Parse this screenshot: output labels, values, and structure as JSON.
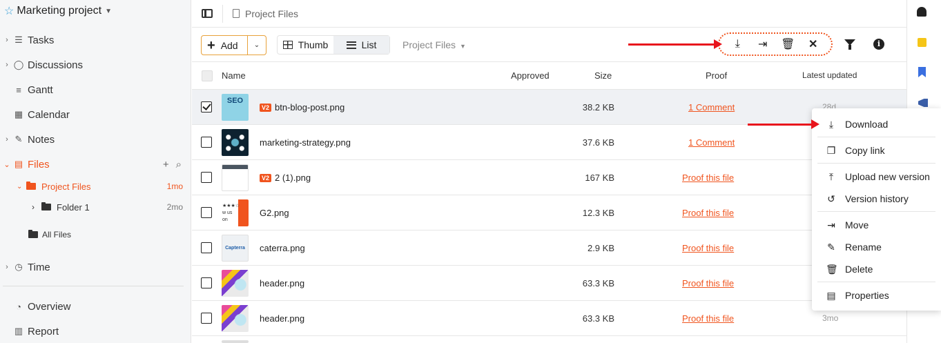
{
  "sidebar": {
    "project_title": "Marketing project",
    "nav": [
      {
        "label": "Tasks"
      },
      {
        "label": "Discussions"
      },
      {
        "label": "Gantt"
      },
      {
        "label": "Calendar"
      },
      {
        "label": "Notes"
      },
      {
        "label": "Files"
      },
      {
        "label": "Time"
      },
      {
        "label": "Overview"
      },
      {
        "label": "Report"
      }
    ],
    "files_tree": {
      "project_files": {
        "label": "Project Files",
        "updated": "1mo"
      },
      "folder1": {
        "label": "Folder 1",
        "updated": "2mo"
      },
      "all_files": {
        "label": "All Files"
      }
    }
  },
  "topbar": {
    "breadcrumb": "Project Files"
  },
  "toolbar": {
    "add_label": "Add",
    "view_thumb": "Thumb",
    "view_list": "List",
    "folder_dropdown": "Project Files"
  },
  "table": {
    "headers": {
      "name": "Name",
      "approved": "Approved",
      "size": "Size",
      "proof": "Proof",
      "updated": "Latest updated"
    },
    "rows": [
      {
        "name": "btn-blog-post.png",
        "version": "V2",
        "size": "38.2 KB",
        "proof": "1 Comment",
        "updated": "28d",
        "thumb": "SEO"
      },
      {
        "name": "marketing-strategy.png",
        "version": "",
        "size": "37.6 KB",
        "proof": "1 Comment",
        "updated": "",
        "thumb": ""
      },
      {
        "name": "2 (1).png",
        "version": "V2",
        "size": "167 KB",
        "proof": "Proof this file",
        "updated": "",
        "thumb": ""
      },
      {
        "name": "G2.png",
        "version": "",
        "size": "12.3 KB",
        "proof": "Proof this file",
        "updated": "",
        "thumb": "★★★☆ w us on"
      },
      {
        "name": "caterra.png",
        "version": "",
        "size": "2.9 KB",
        "proof": "Proof this file",
        "updated": "",
        "thumb": "Capterra"
      },
      {
        "name": "header.png",
        "version": "",
        "size": "63.3 KB",
        "proof": "Proof this file",
        "updated": "",
        "thumb": ""
      },
      {
        "name": "header.png",
        "version": "",
        "size": "63.3 KB",
        "proof": "Proof this file",
        "updated": "3mo",
        "thumb": ""
      }
    ]
  },
  "context_menu": {
    "items": [
      "Download",
      "Copy link",
      "Upload new version",
      "Version history",
      "Move",
      "Rename",
      "Delete",
      "Properties"
    ]
  },
  "colors": {
    "accent": "#f0541e",
    "annotation": "#e8141c",
    "selected_row": "#eff1f4"
  }
}
